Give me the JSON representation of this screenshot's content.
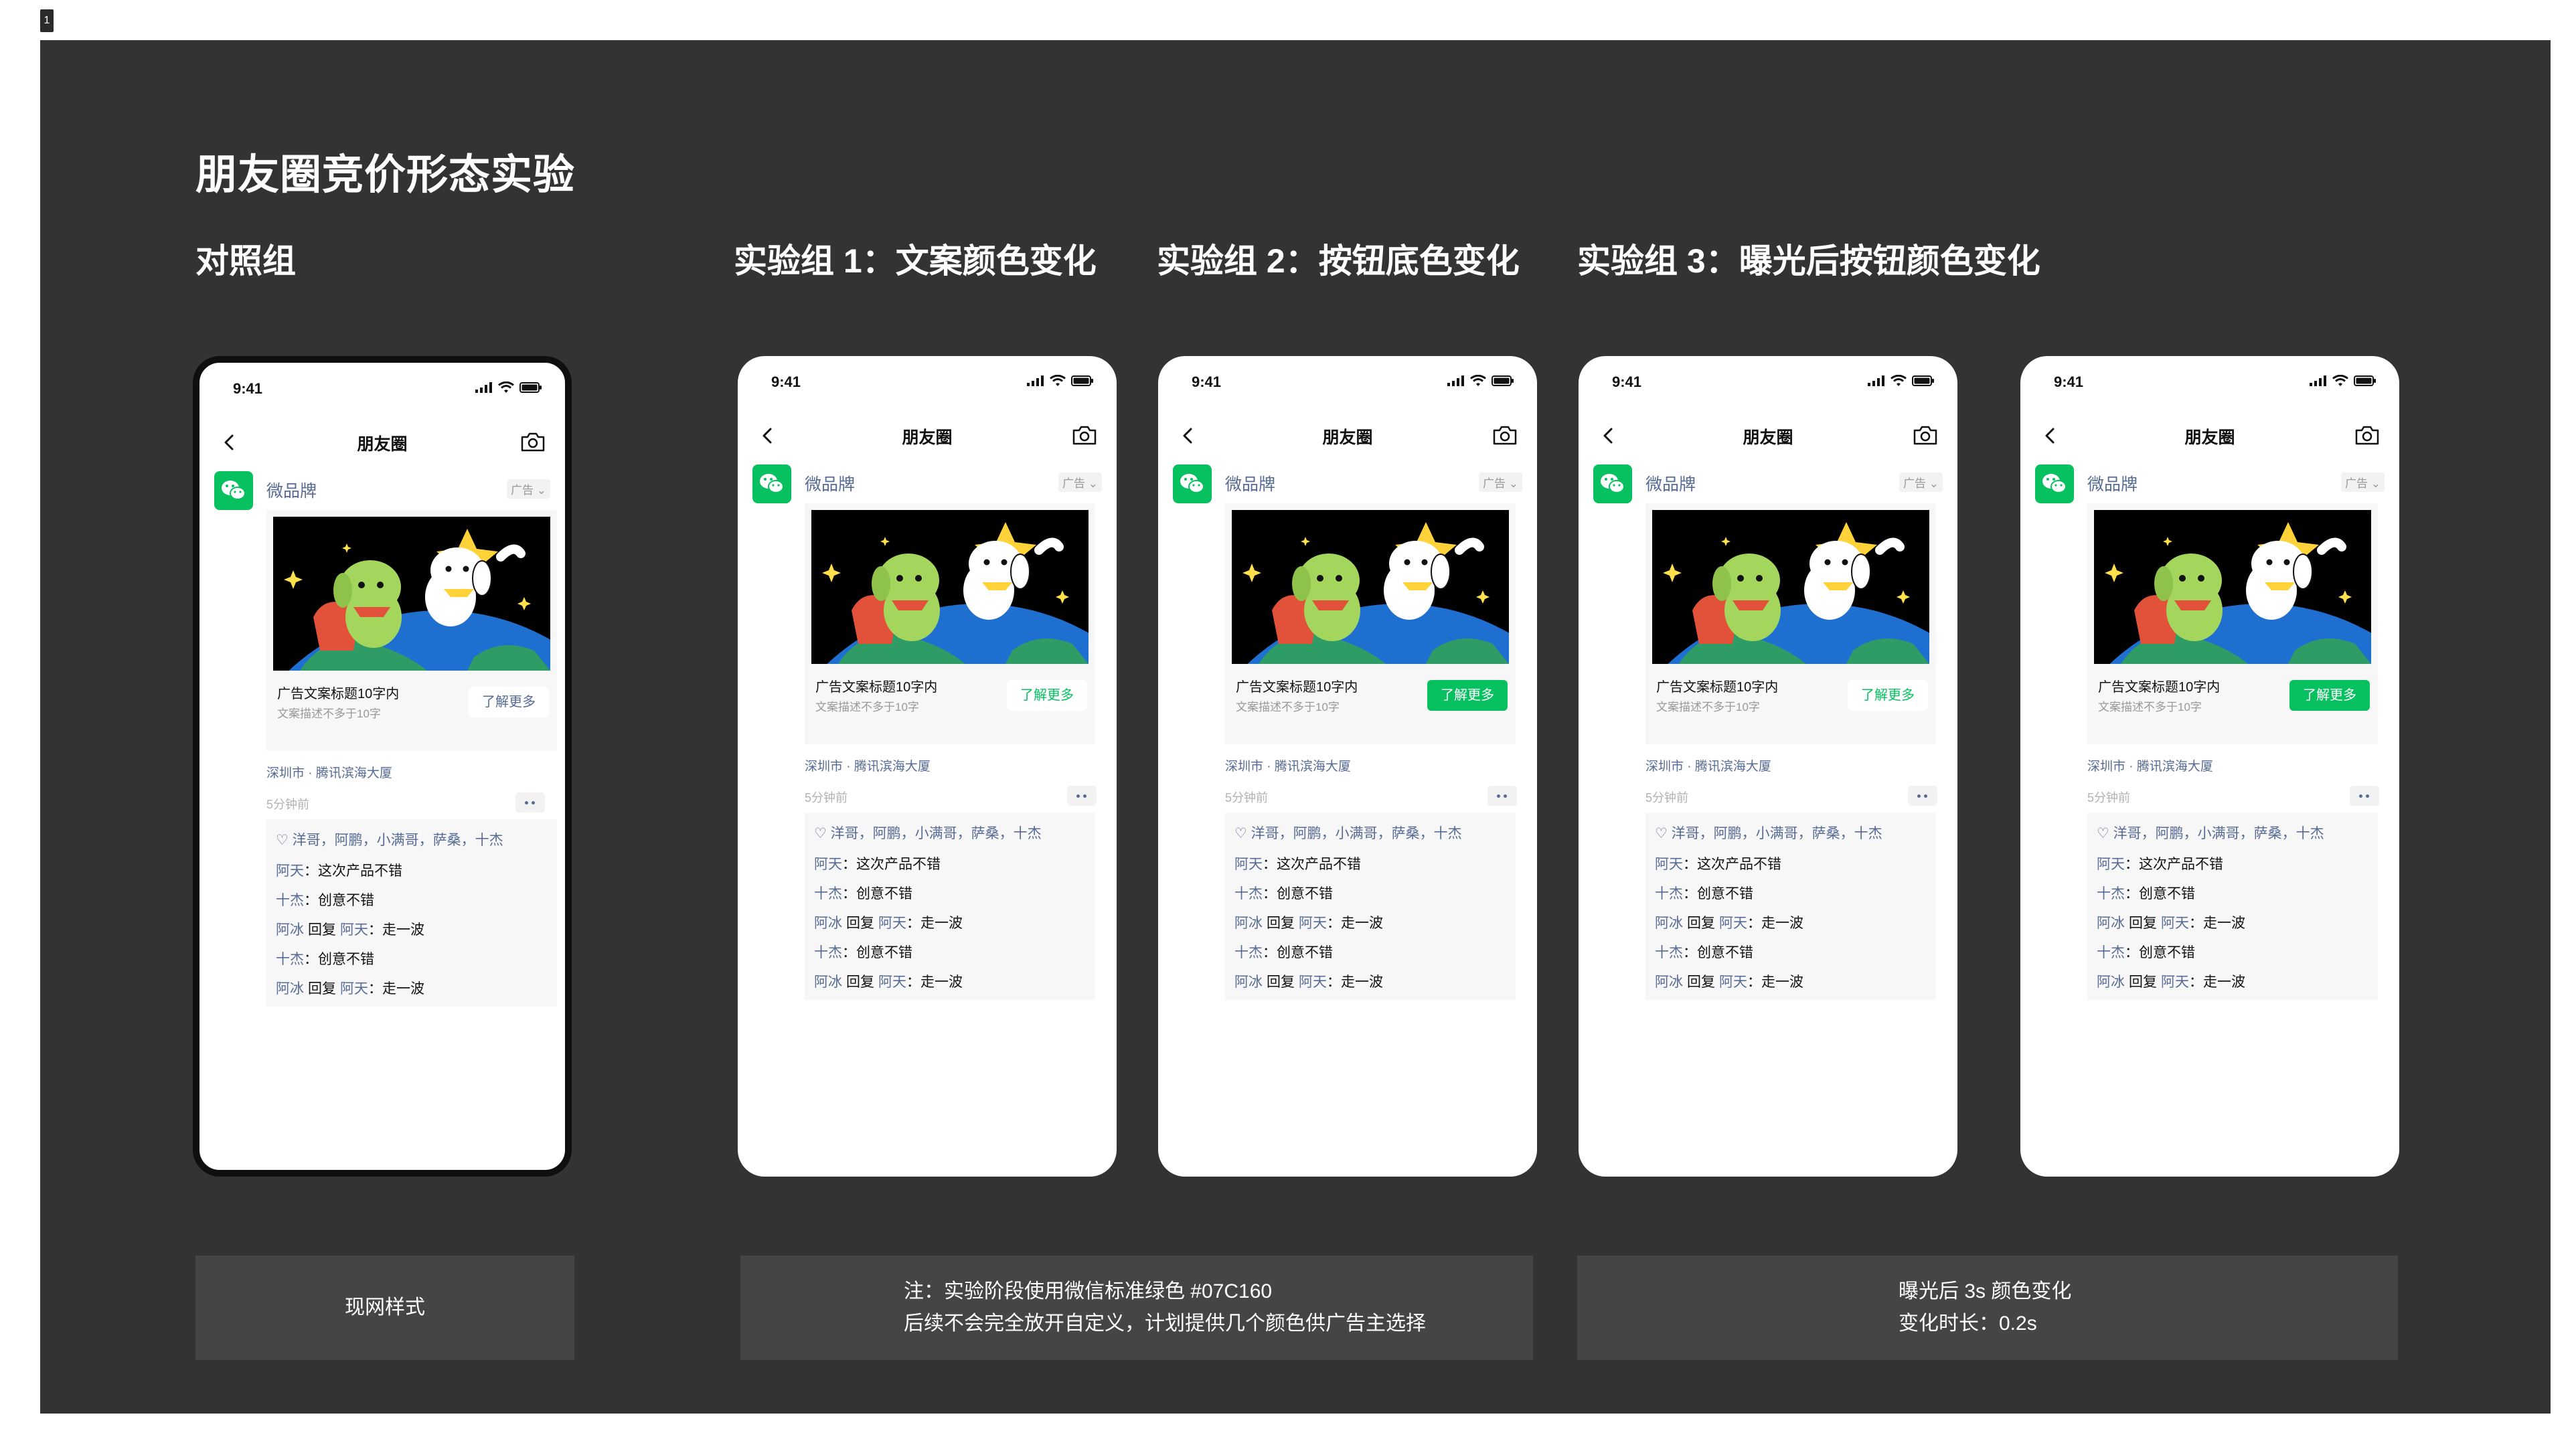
{
  "page_tag": "1",
  "board_title": "朋友圈竞价形态实验",
  "groups": [
    "对照组",
    "实验组 1：文案颜色变化",
    "实验组 2：按钮底色变化",
    "实验组 3：曝光后按钮颜色变化"
  ],
  "phone": {
    "time": "9:41",
    "nav_title": "朋友圈",
    "brand": "微品牌",
    "ad_tag": "广告",
    "ad_title": "广告文案标题10字内",
    "ad_desc": "文案描述不多于10字",
    "cta": "了解更多",
    "location": "深圳市 · 腾讯滨海大厦",
    "time_ago": "5分钟前",
    "likes": "洋哥，阿鹏，小满哥，萨桑，十杰",
    "comments": [
      {
        "name": "阿天",
        "reply_to": "",
        "text": "这次产品不错"
      },
      {
        "name": "十杰",
        "reply_to": "",
        "text": "创意不错"
      },
      {
        "name": "阿冰",
        "reply_to": "阿天",
        "text": "走一波"
      },
      {
        "name": "十杰",
        "reply_to": "",
        "text": "创意不错"
      },
      {
        "name": "阿冰",
        "reply_to": "阿天",
        "text": "走一波"
      }
    ],
    "reply_word": "回复",
    "colon": "："
  },
  "notes": {
    "control": "现网样式",
    "exp12_line1": "注：实验阶段使用微信标准绿色 #07C160",
    "exp12_line2": "后续不会完全放开自定义，计划提供几个颜色供广告主选择",
    "exp3_line1": "曝光后 3s 颜色变化",
    "exp3_line2": "变化时长：0.2s"
  },
  "colors": {
    "board": "#333333",
    "wechat_green": "#07C160",
    "link_blue": "#576B95"
  }
}
